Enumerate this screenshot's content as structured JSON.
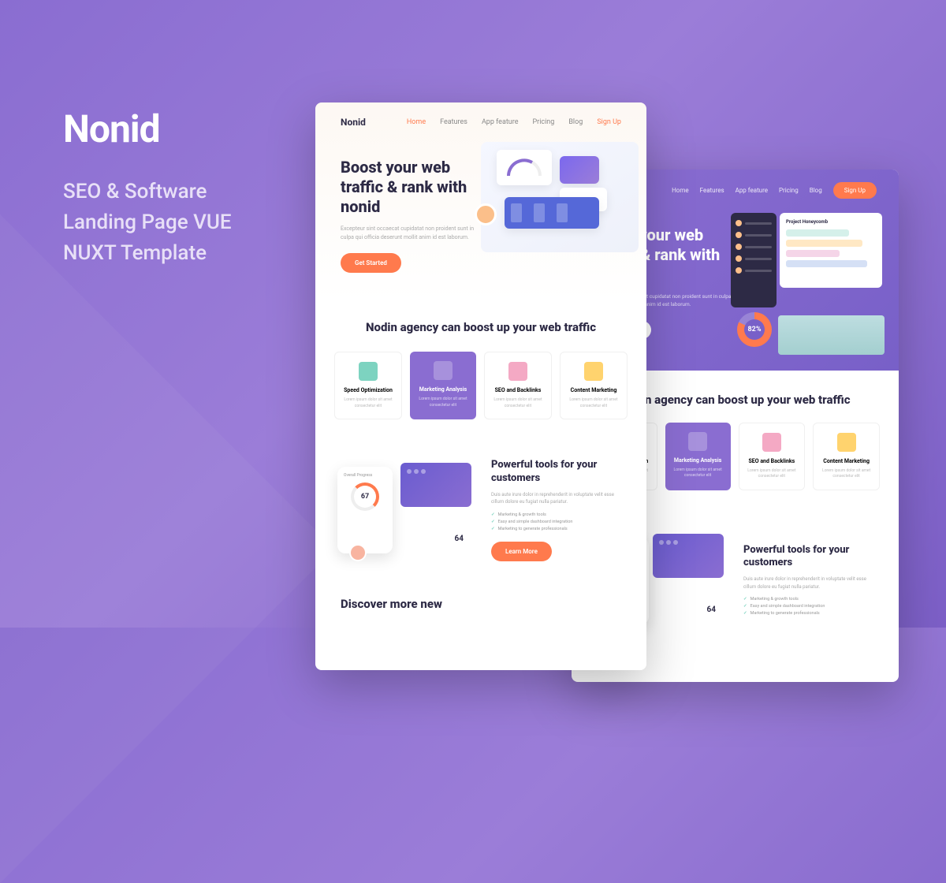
{
  "promo": {
    "logo": "Nonid",
    "subtitle_l1": "SEO & Software",
    "subtitle_l2": "Landing Page VUE",
    "subtitle_l3": "NUXT Template"
  },
  "nav": {
    "logo": "Nonid",
    "items": [
      "Home",
      "Features",
      "App feature",
      "Pricing",
      "Blog"
    ],
    "cta": "Sign Up"
  },
  "hero": {
    "title": "Boost your web traffic & rank with nonid",
    "desc": "Excepteur sint occaecat cupidatat non proident sunt in culpa qui officia deserunt mollit anim id est laborum.",
    "button": "Get Started"
  },
  "section1": {
    "title": "Nodin agency can boost up your web traffic"
  },
  "cards": [
    {
      "title": "Speed Optimization",
      "desc": "Lorem ipsum dolor sit amet consectetur elit"
    },
    {
      "title": "Marketing Analysis",
      "desc": "Lorem ipsum dolor sit amet consectetur elit"
    },
    {
      "title": "SEO and Backlinks",
      "desc": "Lorem ipsum dolor sit amet consectetur elit"
    },
    {
      "title": "Content Marketing",
      "desc": "Lorem ipsum dolor sit amet consectetur elit"
    }
  ],
  "tools": {
    "title": "Powerful tools for your customers",
    "desc": "Duis aute irure dolor in reprehenderit in voluptate velit esse cillum dolore eu fugiat nulla pariatur.",
    "checks": [
      "Marketing & growth tools",
      "Easy and simple dashboard integration",
      "Marketing to generate professionals"
    ],
    "button": "Learn More",
    "ring": "67",
    "stat": "64",
    "phone_head": "Overall Progress"
  },
  "discover": "Discover more new",
  "dashB": {
    "panel_title": "Project Honeycomb",
    "donut": "82%"
  }
}
